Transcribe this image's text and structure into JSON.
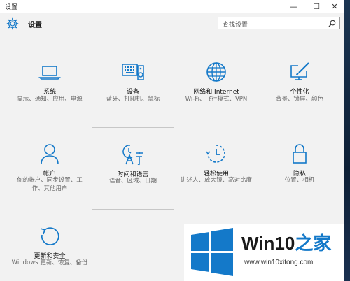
{
  "window": {
    "title": "设置"
  },
  "controls": {
    "minimize": "—",
    "maximize": "☐",
    "close": "✕"
  },
  "header": {
    "app_title": "设置",
    "search_placeholder": "查找设置"
  },
  "tiles": [
    {
      "label": "系统",
      "desc": "显示、通知、应用、电源"
    },
    {
      "label": "设备",
      "desc": "蓝牙、打印机、鼠标"
    },
    {
      "label": "网络和 Internet",
      "desc": "Wi-Fi、飞行模式、VPN"
    },
    {
      "label": "个性化",
      "desc": "背景、锁屏、颜色"
    },
    {
      "label": "帐户",
      "desc": "你的帐户、同步设置、工作、其他用户"
    },
    {
      "label": "时间和语言",
      "desc": "语音、区域、日期"
    },
    {
      "label": "轻松使用",
      "desc": "讲述人、放大镜、高对比度"
    },
    {
      "label": "隐私",
      "desc": "位置、相机"
    },
    {
      "label": "更新和安全",
      "desc": "Windows 更新、恢复、备份"
    }
  ],
  "watermark": {
    "brand": "Win10",
    "brand_accent": "之家",
    "url": "www.win10xitong.com"
  },
  "colors": {
    "accent": "#1479c9",
    "background": "#f2f2f2"
  }
}
